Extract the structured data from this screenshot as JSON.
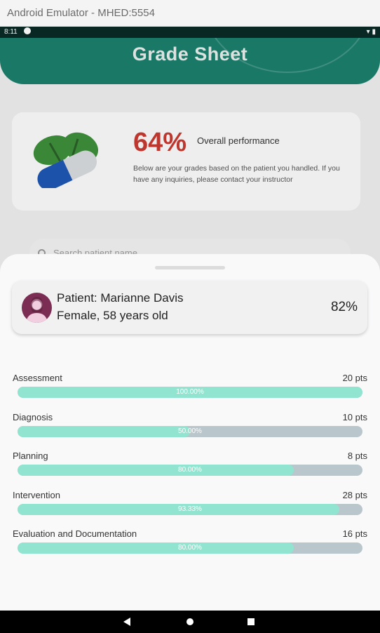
{
  "window": {
    "title": "Android Emulator - MHED:5554"
  },
  "status_bar": {
    "time": "8:11"
  },
  "header": {
    "title": "Grade Sheet"
  },
  "summary": {
    "percent": "64%",
    "label": "Overall performance",
    "description": "Below are your grades based on the patient you handled. If you have any inquiries, please contact your instructor"
  },
  "search": {
    "placeholder": "Search patient name"
  },
  "patient": {
    "name": "Patient: Marianne Davis",
    "description": "Female, 58 years old",
    "score": "82%"
  },
  "grades": [
    {
      "name": "Assessment",
      "points": "20 pts",
      "percent_label": "100.00%",
      "fraction": 1.0
    },
    {
      "name": "Diagnosis",
      "points": "10 pts",
      "percent_label": "50.00%",
      "fraction": 0.5
    },
    {
      "name": "Planning",
      "points": "8 pts",
      "percent_label": "80.00%",
      "fraction": 0.8
    },
    {
      "name": "Intervention",
      "points": "28 pts",
      "percent_label": "93.33%",
      "fraction": 0.9333
    },
    {
      "name": "Evaluation and Documentation",
      "points": "16 pts",
      "percent_label": "80.00%",
      "fraction": 0.8
    }
  ],
  "colors": {
    "header": "#1c7f6d",
    "percent_red": "#c93a32",
    "bar_fill": "#91e4cf",
    "bar_track": "#b9c6cb",
    "avatar": "#7b2d53"
  },
  "icons": {
    "status": [
      "notification-icon",
      "wifi-icon",
      "battery-icon"
    ],
    "summary": "pill-leaves-icon",
    "search": "search-icon",
    "avatar": "female-avatar-icon",
    "nav": [
      "back-icon",
      "home-icon",
      "recents-icon"
    ]
  }
}
